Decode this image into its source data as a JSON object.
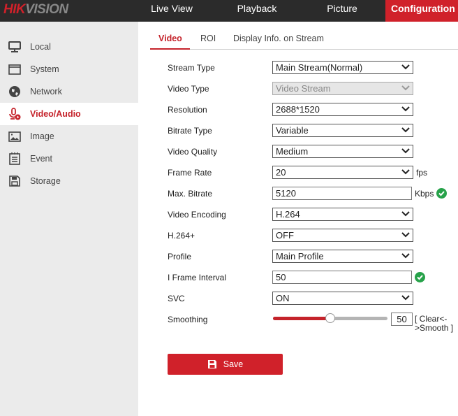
{
  "header": {
    "logo": "HIKVISION",
    "nav": [
      {
        "label": "Live View"
      },
      {
        "label": "Playback"
      },
      {
        "label": "Picture"
      },
      {
        "label": "Configuration",
        "active": true
      }
    ]
  },
  "sidebar": {
    "items": [
      {
        "label": "Local",
        "icon": "monitor-icon"
      },
      {
        "label": "System",
        "icon": "window-icon"
      },
      {
        "label": "Network",
        "icon": "globe-icon"
      },
      {
        "label": "Video/Audio",
        "icon": "mic-video-icon",
        "active": true
      },
      {
        "label": "Image",
        "icon": "image-icon"
      },
      {
        "label": "Event",
        "icon": "calendar-icon"
      },
      {
        "label": "Storage",
        "icon": "floppy-icon"
      }
    ]
  },
  "tabs": [
    {
      "label": "Video",
      "active": true
    },
    {
      "label": "ROI"
    },
    {
      "label": "Display Info. on Stream"
    }
  ],
  "form": {
    "stream_type": {
      "label": "Stream Type",
      "value": "Main Stream(Normal)"
    },
    "video_type": {
      "label": "Video Type",
      "value": "Video Stream"
    },
    "resolution": {
      "label": "Resolution",
      "value": "2688*1520"
    },
    "bitrate_type": {
      "label": "Bitrate Type",
      "value": "Variable"
    },
    "video_quality": {
      "label": "Video Quality",
      "value": "Medium"
    },
    "frame_rate": {
      "label": "Frame Rate",
      "value": "20",
      "unit": "fps"
    },
    "max_bitrate": {
      "label": "Max. Bitrate",
      "value": "5120",
      "unit": "Kbps"
    },
    "video_encoding": {
      "label": "Video Encoding",
      "value": "H.264"
    },
    "h264plus": {
      "label": "H.264+",
      "value": "OFF"
    },
    "profile": {
      "label": "Profile",
      "value": "Main Profile"
    },
    "i_frame": {
      "label": "I Frame Interval",
      "value": "50"
    },
    "svc": {
      "label": "SVC",
      "value": "ON"
    },
    "smoothing": {
      "label": "Smoothing",
      "value": "50",
      "percent": 50,
      "range_label": "[ Clear<->Smooth ]"
    }
  },
  "save_label": "Save",
  "colors": {
    "accent": "#d0212a",
    "valid": "#27a24a"
  }
}
